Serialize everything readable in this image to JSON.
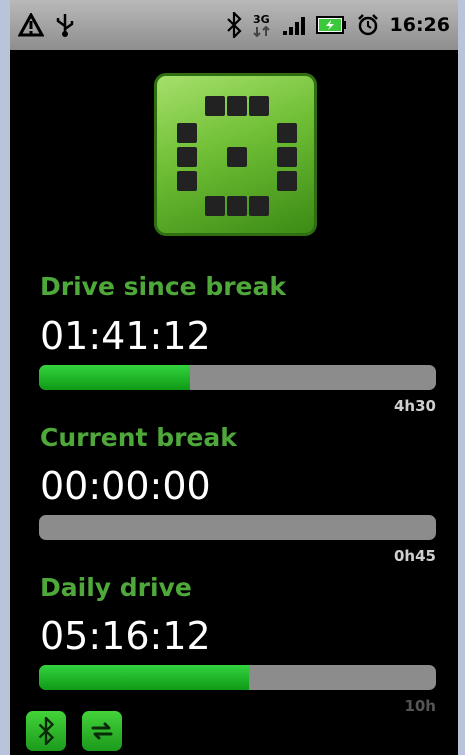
{
  "status_bar": {
    "time": "16:26",
    "network": "3G",
    "icons": [
      "warning-icon",
      "usb-icon",
      "bluetooth-icon",
      "network-3g-icon",
      "signal-icon",
      "battery-charging-icon",
      "alarm-icon"
    ]
  },
  "sections": [
    {
      "title": "Drive since break",
      "timer": "01:41:12",
      "limit": "4h30",
      "progress": 0.38
    },
    {
      "title": "Current break",
      "timer": "00:00:00",
      "limit": "0h45",
      "progress": 0.0
    },
    {
      "title": "Daily drive",
      "timer": "05:16:12",
      "limit": "10h",
      "progress": 0.53
    }
  ],
  "bottom_buttons": [
    "bluetooth-button-icon",
    "sync-button-icon"
  ],
  "colors": {
    "accent_green": "#4ea83a",
    "progress_green": "#1fb82a",
    "progress_track": "#8c8c8c"
  }
}
